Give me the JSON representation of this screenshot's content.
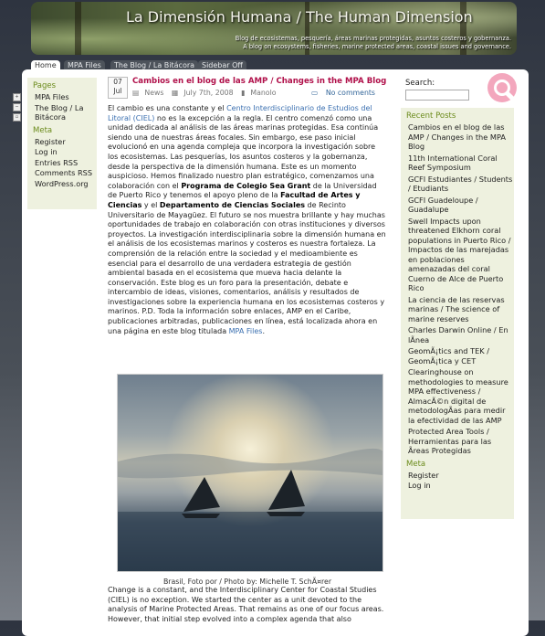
{
  "site": {
    "title": "La Dimensión Humana / The Human Dimension",
    "description_line1": "Blog de ecosistemas, pesquería, áreas marinas protegidas, asuntos costeros y gobernanza.",
    "description_line2": "A blog on ecosystems, fisheries, marine protected areas, coastal issues and governance."
  },
  "tabs": [
    "Home",
    "MPA Files",
    "The Blog / La Bitácora",
    "Sidebar Off"
  ],
  "left_sidebar": {
    "pages_title": "Pages",
    "pages": [
      "MPA Files",
      "The Blog / La Bitácora"
    ],
    "meta_title": "Meta",
    "meta": [
      "Register",
      "Log in",
      "Entries RSS",
      "Comments RSS",
      "WordPress.org"
    ]
  },
  "post": {
    "day": "07",
    "month": "Jul",
    "title": "Cambios en el blog de las AMP / Changes in the MPA Blog",
    "category": "News",
    "date": "July 7th, 2008",
    "author": "Manolo",
    "comments": "No comments",
    "link_ciel": "Centro Interdisciplinario de Estudios del Litoral (CIEL)",
    "program_sea_grant": "Programa de Colegio Sea Grant",
    "faculty": "Facultad de Artes y Ciencias",
    "department": "Departamento de Ciencias Sociales",
    "link_mpa_files": "MPA Files",
    "caption": "Brasil, Foto por / Photo by: Michelle T. SchÃ¤rer",
    "link_ccs": "Interdisciplinary Center for Coastal Studies"
  },
  "search": {
    "label": "Search:",
    "placeholder": ""
  },
  "right_sidebar": {
    "recent_title": "Recent Posts",
    "recent_posts": [
      "Cambios en el blog de las AMP / Changes in the MPA Blog",
      "11th International Coral Reef Symposium",
      "GCFI Estudiantes / Students / Etudiants",
      "GCFI Guadeloupe / Guadalupe",
      "Swell Impacts upon threatened Elkhorn coral populations in Puerto Rico / Impactos de las marejadas en poblaciones amenazadas del coral Cuerno de Alce de Puerto Rico",
      "La ciencia de las reservas marinas / The science of marine reserves",
      "Charles Darwin Online / En lÃnea",
      "GeomÃ¡tics and TEK / GeomÃ¡tica y CET",
      "Clearinghouse on methodologies to measure MPA effectiveness / AlmacÃ©n digital de metodologÃ­as para medir la efectividad de las AMP",
      "Protected Area Tools / Herramientas para las Ãreas Protegidas"
    ],
    "meta_title": "Meta",
    "meta": [
      "Register",
      "Log in"
    ]
  },
  "colors": {
    "accent": "#b0104a",
    "link": "#3a6fb0",
    "section": "#6a8a1a",
    "sidebar_bg": "#eef1df"
  }
}
